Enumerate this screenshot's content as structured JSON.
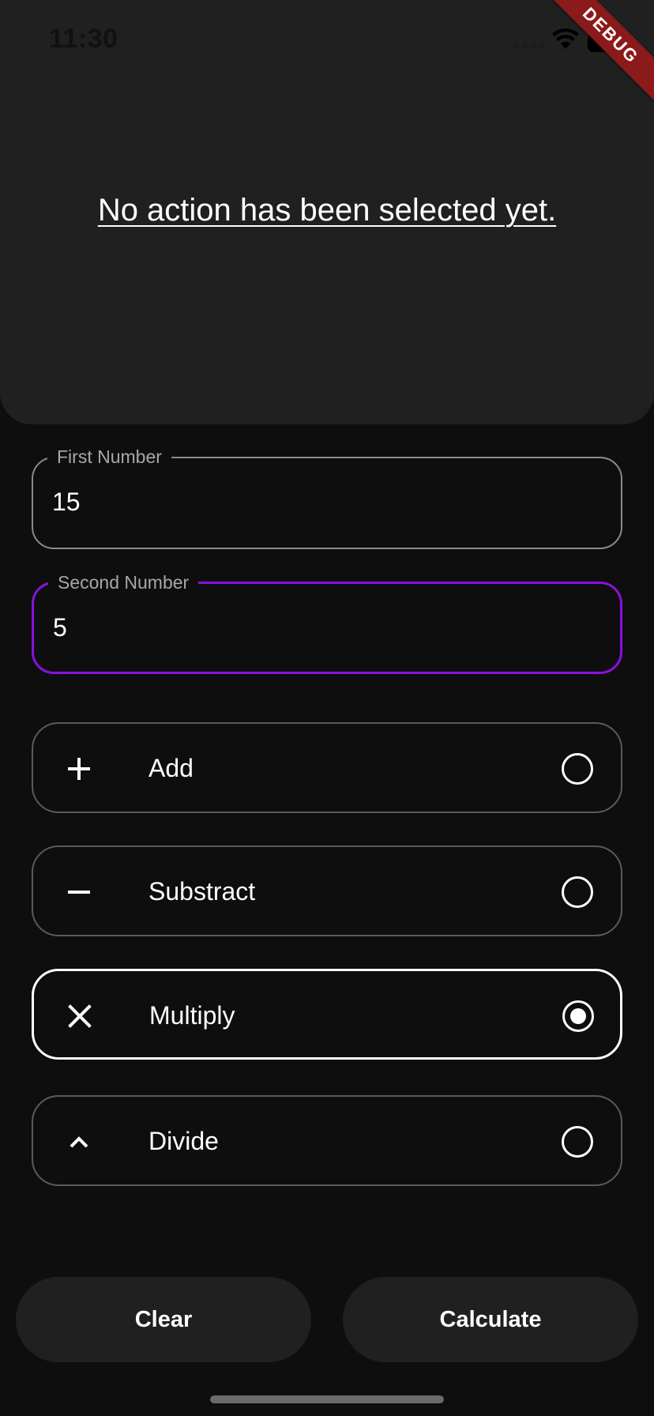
{
  "status_bar": {
    "time": "11:30"
  },
  "debug_banner": "DEBUG",
  "result": {
    "text": "No action has been selected yet."
  },
  "fields": {
    "first": {
      "label": "First Number",
      "value": "15"
    },
    "second": {
      "label": "Second Number",
      "value": "5"
    }
  },
  "operations": [
    {
      "label": "Add",
      "icon": "plus-icon",
      "selected": false
    },
    {
      "label": "Substract",
      "icon": "minus-icon",
      "selected": false
    },
    {
      "label": "Multiply",
      "icon": "close-x-icon",
      "selected": true
    },
    {
      "label": "Divide",
      "icon": "caret-up-icon",
      "selected": false
    }
  ],
  "buttons": {
    "clear": "Clear",
    "calculate": "Calculate"
  },
  "colors": {
    "accent": "#8a10e0",
    "card": "#202020",
    "background": "#0e0e0e",
    "debug": "#8b1a1a"
  }
}
